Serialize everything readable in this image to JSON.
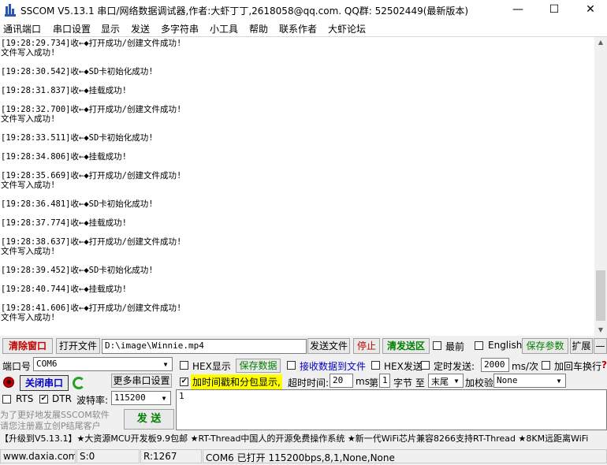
{
  "window": {
    "title": "SSCOM V5.13.1 串口/网络数据调试器,作者:大虾丁丁,2618058@qq.com. QQ群: 52502449(最新版本)",
    "minimize": "—",
    "maximize": "☐",
    "close": "✕"
  },
  "menu": [
    "通讯端口",
    "串口设置",
    "显示",
    "发送",
    "多字符串",
    "小工具",
    "帮助",
    "联系作者",
    "大虾论坛"
  ],
  "log": [
    {
      "line": "[19:28:29.734]收←◆打开成功/创建文件成功!",
      "cont": "文件写入成功!"
    },
    {
      "line": "[19:28:30.542]收←◆SD卡初始化成功!",
      "cont": ""
    },
    {
      "line": "[19:28:31.837]收←◆挂载成功!",
      "cont": ""
    },
    {
      "line": "[19:28:32.700]收←◆打开成功/创建文件成功!",
      "cont": "文件写入成功!"
    },
    {
      "line": "[19:28:33.511]收←◆SD卡初始化成功!",
      "cont": ""
    },
    {
      "line": "[19:28:34.806]收←◆挂载成功!",
      "cont": ""
    },
    {
      "line": "[19:28:35.669]收←◆打开成功/创建文件成功!",
      "cont": "文件写入成功!"
    },
    {
      "line": "[19:28:36.481]收←◆SD卡初始化成功!",
      "cont": ""
    },
    {
      "line": "[19:28:37.774]收←◆挂载成功!",
      "cont": ""
    },
    {
      "line": "[19:28:38.637]收←◆打开成功/创建文件成功!",
      "cont": "文件写入成功!"
    },
    {
      "line": "[19:28:39.452]收←◆SD卡初始化成功!",
      "cont": ""
    },
    {
      "line": "[19:28:40.744]收←◆挂载成功!",
      "cont": ""
    },
    {
      "line": "[19:28:41.606]收←◆打开成功/创建文件成功!",
      "cont": "文件写入成功!"
    }
  ],
  "toolbar": {
    "clear_window": "清除窗口",
    "open_file": "打开文件",
    "file_path": "D:\\image\\Winnie.mp4",
    "send_file": "发送文件",
    "stop": "停止",
    "clear_send_area": "清发送区",
    "topmost": "最前",
    "english": "English",
    "save_params": "保存参数",
    "expand": "扩展",
    "collapse": "—"
  },
  "port": {
    "port_label": "端口号",
    "port_value": "COM6",
    "more_settings": "更多串口设置",
    "close_port": "关闭串口",
    "rts": "RTS",
    "dtr": "DTR",
    "baud_label": "波特率:",
    "baud_value": "115200"
  },
  "options": {
    "hex_display": "HEX显示",
    "save_data": "保存数据",
    "recv_to_file": "接收数据到文件",
    "hex_send": "HEX发送",
    "timed_send": "定时发送:",
    "interval_value": "2000",
    "interval_unit": "ms/次",
    "add_crlf": "加回车换行",
    "timestamp": "加时间戳和分包显示,",
    "timeout_label": "超时时间:",
    "timeout_value": "20",
    "timeout_unit": "ms",
    "byte_label_pre": "第",
    "byte_index": "1",
    "byte_label_post": "字节 至",
    "byte_end": "末尾",
    "checksum_label": "加校验",
    "checksum_value": "None"
  },
  "send": {
    "input_value": "1",
    "send_button": "发 送",
    "promo_line1": "为了更好地发展SSCOM软件",
    "promo_line2": "请您注册嘉立创P结尾客户"
  },
  "ticker": "【升级到V5.13.1】★大资源MCU开发板9.9包邮 ★RT-Thread中国人的开源免费操作系统 ★新一代WiFi芯片兼容8266支持RT-Thread ★8KM远距离WiFi",
  "status": {
    "site": "www.daxia.com",
    "sent": "S:0",
    "received": "R:1267",
    "port_state": "COM6 已打开  115200bps,8,1,None,None"
  },
  "colors": {
    "accent_red": "#c00000",
    "accent_green": "#008000",
    "timestamp_highlight": "#ffff00",
    "ticker_link": "#0000cc"
  }
}
